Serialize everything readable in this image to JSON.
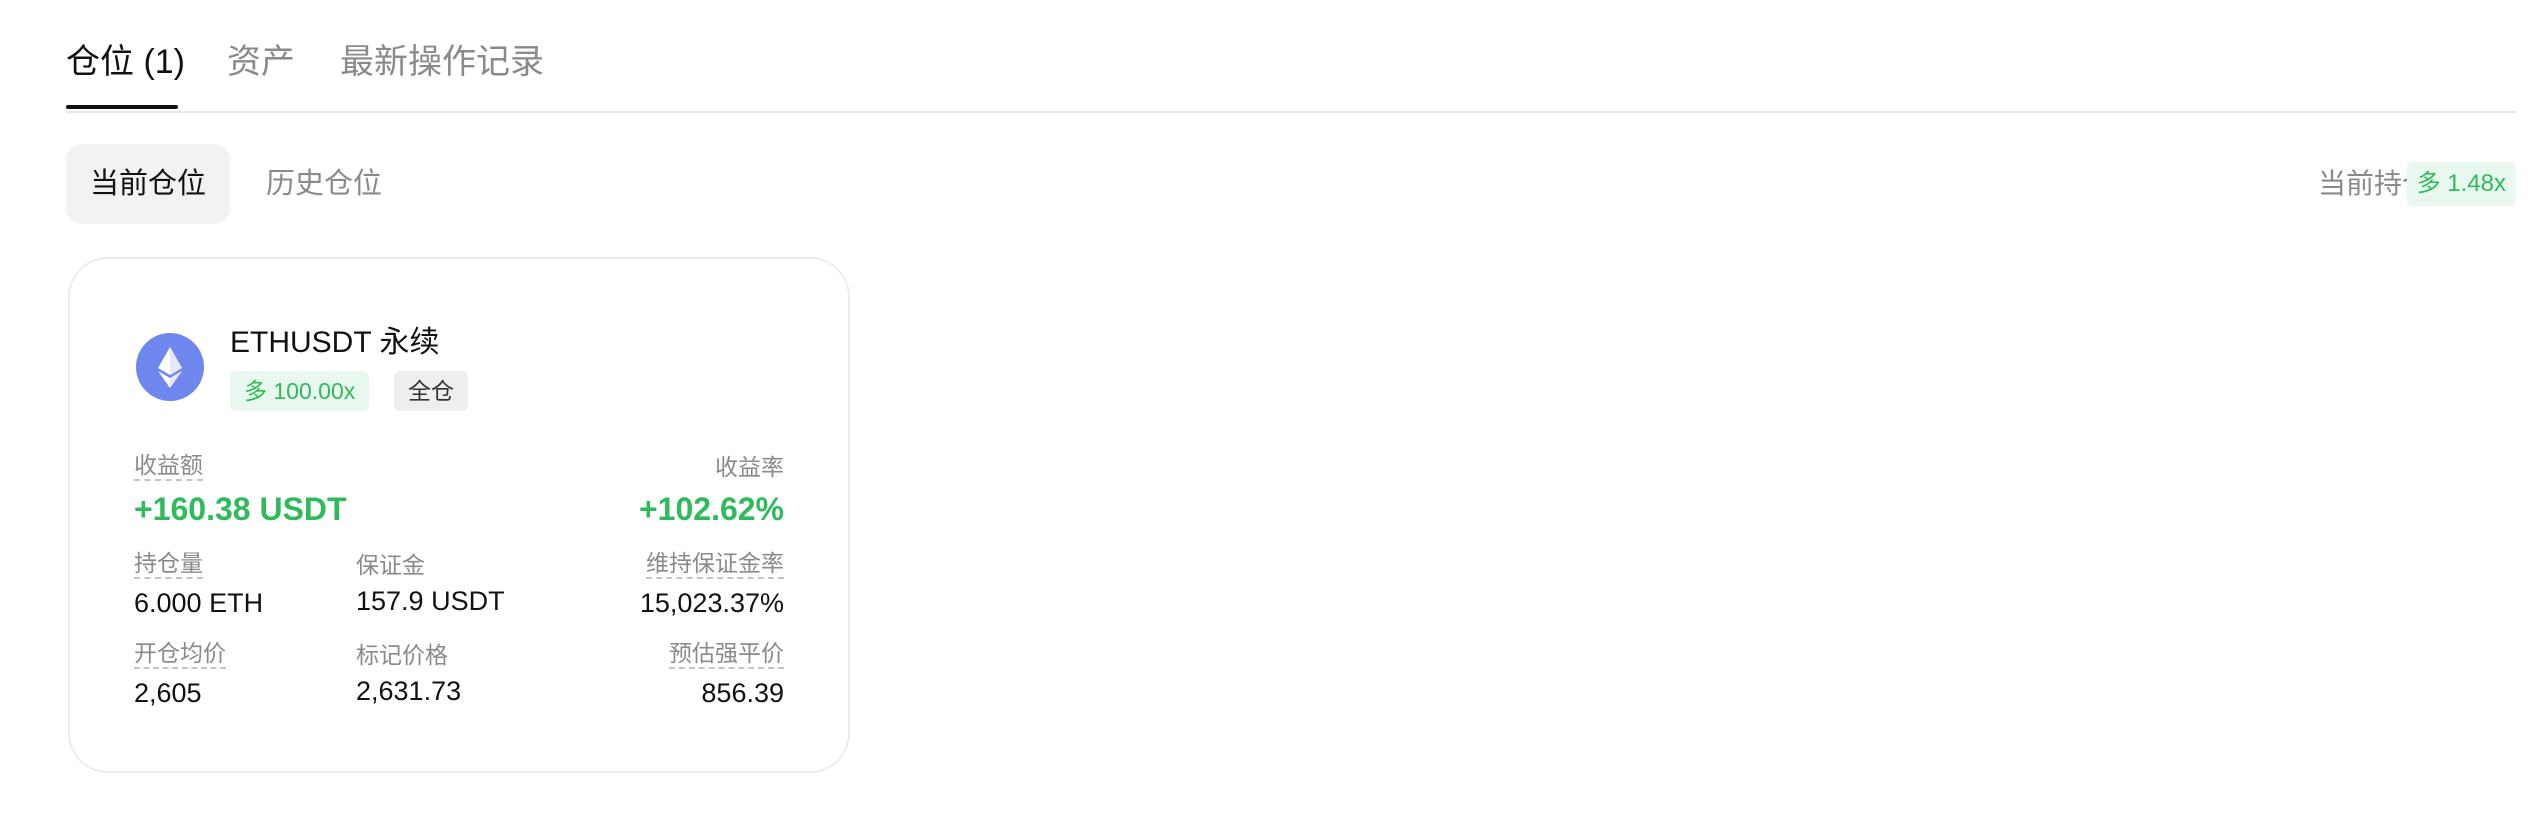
{
  "tabs": {
    "position_label": "仓位 (1)",
    "assets_label": "资产",
    "records_label": "最新操作记录"
  },
  "subtabs": {
    "current_label": "当前仓位",
    "history_label": "历史仓位"
  },
  "summary": {
    "current_holding_label": "当前持仓",
    "current_holding_badge": "多 1.48x"
  },
  "position": {
    "symbol": "ETHUSDT 永续",
    "coin_icon": "ethereum-icon",
    "side_leverage": "多 100.00x",
    "margin_mode": "全仓",
    "pnl_label": "收益额",
    "pnl_value": "+160.38 USDT",
    "roe_label": "收益率",
    "roe_value": "+102.62%",
    "size_label": "持仓量",
    "size_value": "6.000 ETH",
    "margin_label": "保证金",
    "margin_value": "157.9 USDT",
    "mmr_label": "维持保证金率",
    "mmr_value": "15,023.37%",
    "entry_label": "开仓均价",
    "entry_value": "2,605",
    "mark_label": "标记价格",
    "mark_value": "2,631.73",
    "liq_label": "预估强平价",
    "liq_value": "856.39"
  },
  "colors": {
    "accent_green": "#2fba5b",
    "green_bg": "#e9f8ee",
    "eth_blue": "#6f86ee",
    "muted_text": "#8a8a8a"
  }
}
